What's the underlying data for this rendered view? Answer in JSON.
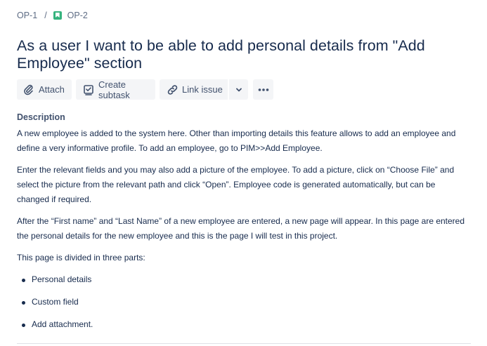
{
  "breadcrumb": {
    "parent": "OP-1",
    "separator": "/",
    "current": "OP-2",
    "current_icon": "story-icon"
  },
  "issue": {
    "title": "As a user I want to be able to add personal details from \"Add Employee\" section"
  },
  "toolbar": {
    "attach_label": "Attach",
    "attach_icon": "paperclip-icon",
    "subtask_label": "Create subtask",
    "subtask_icon": "subtask-icon",
    "link_label": "Link issue",
    "link_icon": "link-icon",
    "dropdown_icon": "chevron-down-icon",
    "more_icon": "more-icon"
  },
  "description": {
    "heading": "Description",
    "paragraphs": [
      "A new employee is added to the system here. Other than importing details this feature allows to add an employee and define a very informative profile. To add an employee, go to PIM>>Add Employee.",
      "Enter the relevant fields and you may also add a picture of the employee. To add a picture, click on “Choose File” and select the picture from the relevant path and click “Open”. Employee code is generated automatically, but can be changed if required.",
      "After the “First name” and “Last Name” of a new employee are entered, a new page will appear. In this page are entered the personal details for the new employee and this is the page  I will test in this project.",
      "This page is divided in three parts:"
    ],
    "list": [
      "Personal details",
      "Custom field",
      "Add attachment."
    ]
  },
  "colors": {
    "text": "#172b4d",
    "subtle_text": "#42526e",
    "button_bg": "#f4f5f7",
    "story_green": "#36b37e"
  }
}
